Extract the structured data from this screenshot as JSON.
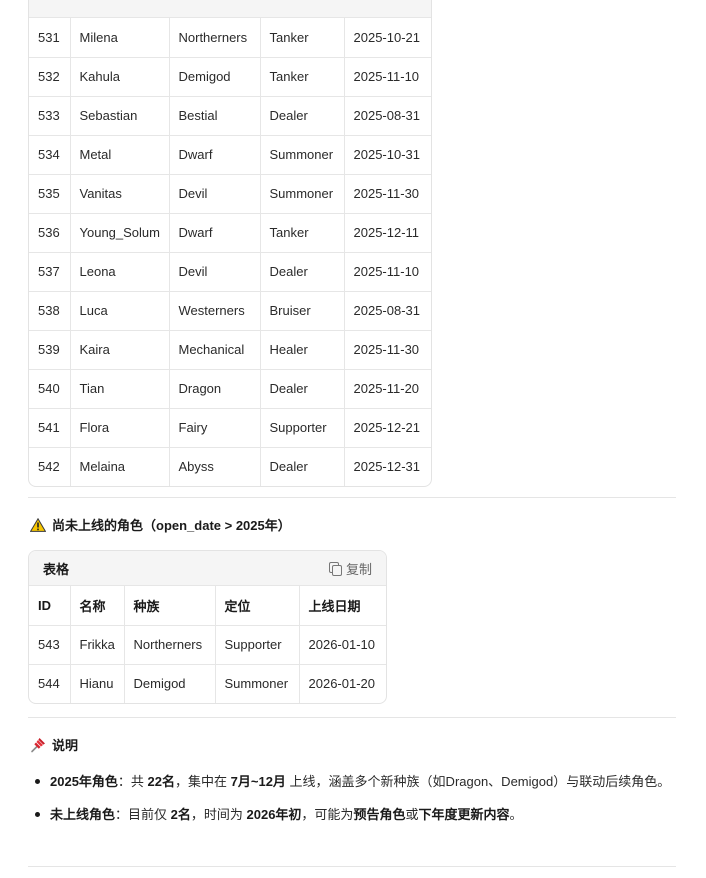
{
  "table1": {
    "rows": [
      [
        "531",
        "Milena",
        "Northerners",
        "Tanker",
        "2025-10-21"
      ],
      [
        "532",
        "Kahula",
        "Demigod",
        "Tanker",
        "2025-11-10"
      ],
      [
        "533",
        "Sebastian",
        "Bestial",
        "Dealer",
        "2025-08-31"
      ],
      [
        "534",
        "Metal",
        "Dwarf",
        "Summoner",
        "2025-10-31"
      ],
      [
        "535",
        "Vanitas",
        "Devil",
        "Summoner",
        "2025-11-30"
      ],
      [
        "536",
        "Young_Solum",
        "Dwarf",
        "Tanker",
        "2025-12-11"
      ],
      [
        "537",
        "Leona",
        "Devil",
        "Dealer",
        "2025-11-10"
      ],
      [
        "538",
        "Luca",
        "Westerners",
        "Bruiser",
        "2025-08-31"
      ],
      [
        "539",
        "Kaira",
        "Mechanical",
        "Healer",
        "2025-11-30"
      ],
      [
        "540",
        "Tian",
        "Dragon",
        "Dealer",
        "2025-11-20"
      ],
      [
        "541",
        "Flora",
        "Fairy",
        "Supporter",
        "2025-12-21"
      ],
      [
        "542",
        "Melaina",
        "Abyss",
        "Dealer",
        "2025-12-31"
      ]
    ]
  },
  "unreleased": {
    "heading": "尚未上线的角色（open_date > 2025年）",
    "table_label": "表格",
    "copy_label": "复制",
    "headers": [
      "ID",
      "名称",
      "种族",
      "定位",
      "上线日期"
    ],
    "rows": [
      [
        "543",
        "Frikka",
        "Northerners",
        "Supporter",
        "2026-01-10"
      ],
      [
        "544",
        "Hianu",
        "Demigod",
        "Summoner",
        "2026-01-20"
      ]
    ]
  },
  "notes": {
    "heading": "说明",
    "items": [
      {
        "label": "2025年角色",
        "p1": "：共 ",
        "b1": "22名",
        "p2": "，集中在 ",
        "b2": "7月~12月",
        "p3": " 上线，涵盖多个新种族（如Dragon、Demigod）与联动后续角色。"
      },
      {
        "label": "未上线角色",
        "p1": "：目前仅 ",
        "b1": "2名",
        "p2": "，时间为 ",
        "b2": "2026年初",
        "p3": "，可能为",
        "b3": "预告角色",
        "p4": "或",
        "b4": "下年度更新内容",
        "p5": "。"
      }
    ]
  },
  "icons": {
    "warning": "warning-icon",
    "pin": "pushpin-icon",
    "copy": "copy-icon"
  }
}
